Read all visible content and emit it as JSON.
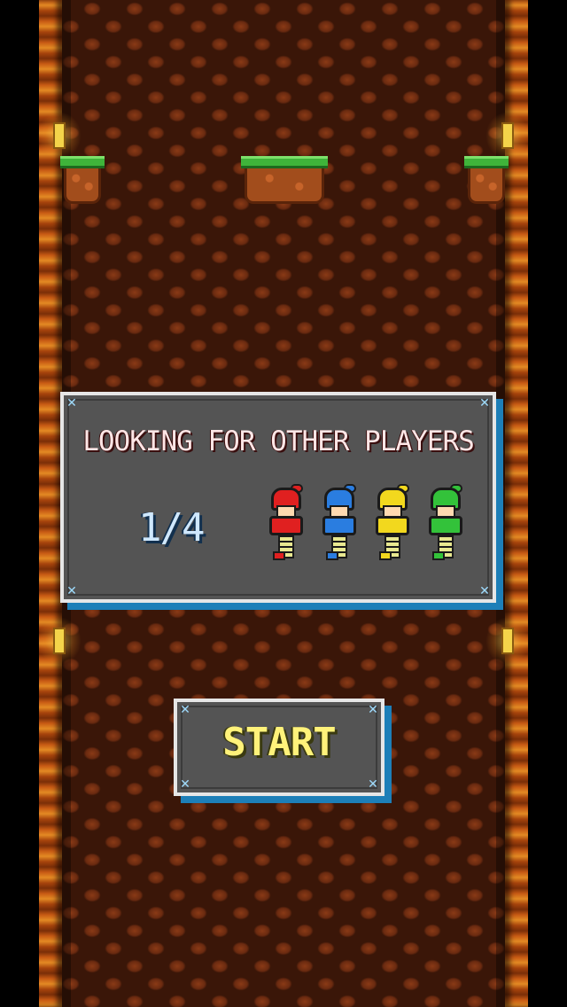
{
  "dialog": {
    "title": "LOOKING FOR OTHER PLAYERS",
    "player_count": "1/4",
    "players": [
      {
        "color": "red",
        "hex": "#e02020"
      },
      {
        "color": "blue",
        "hex": "#2a7de0"
      },
      {
        "color": "yellow",
        "hex": "#f2d81e"
      },
      {
        "color": "green",
        "hex": "#33c23a"
      }
    ]
  },
  "start_button": {
    "label": "START"
  },
  "colors": {
    "panel_fill": "#545454",
    "panel_border": "#e6e6e6",
    "panel_shadow": "#1d7fb8",
    "corner_marks": "#9fdcff",
    "start_text": "#fff27a",
    "cave_dark": "#3a1608",
    "cave_rock": "#8a3a16",
    "grass": "#3fb43a"
  },
  "icons": {
    "torch": "torch-icon",
    "corner": "corner-marker-icon"
  }
}
